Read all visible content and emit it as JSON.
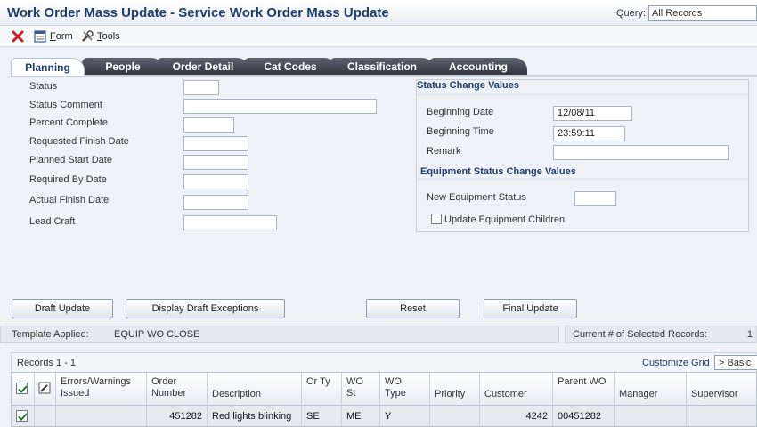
{
  "window": {
    "title": "Work Order Mass Update - Service Work Order Mass Update"
  },
  "query": {
    "label": "Query:",
    "value": "All Records"
  },
  "toolbar": {
    "form_label_u": "F",
    "form_label_rest": "orm",
    "tools_label_u": "T",
    "tools_label_rest": "ools"
  },
  "tabs": [
    {
      "label": "Planning",
      "active": true
    },
    {
      "label": "People"
    },
    {
      "label": "Order Detail"
    },
    {
      "label": "Cat Codes"
    },
    {
      "label": "Classification"
    },
    {
      "label": "Accounting"
    }
  ],
  "planning": {
    "status_label": "Status",
    "status_value": "",
    "status_comment_label": "Status Comment",
    "status_comment_value": "",
    "percent_complete_label": "Percent Complete",
    "percent_complete_value": "",
    "requested_finish_label": "Requested Finish Date",
    "requested_finish_value": "",
    "planned_start_label": "Planned Start Date",
    "planned_start_value": "",
    "required_by_label": "Required By Date",
    "required_by_value": "",
    "actual_finish_label": "Actual Finish Date",
    "actual_finish_value": "",
    "lead_craft_label": "Lead Craft",
    "lead_craft_value": ""
  },
  "status_change": {
    "heading": "Status Change Values",
    "beginning_date_label": "Beginning Date",
    "beginning_date_value": "12/08/11",
    "beginning_time_label": "Beginning Time",
    "beginning_time_value": "23:59:11",
    "remark_label": "Remark",
    "remark_value": ""
  },
  "equipment_change": {
    "heading": "Equipment Status Change Values",
    "new_status_label": "New Equipment Status",
    "new_status_value": "",
    "update_children_label": "Update Equipment Children",
    "update_children_checked": false
  },
  "buttons": {
    "draft_update": "Draft Update",
    "display_draft_exceptions": "Display Draft Exceptions",
    "reset": "Reset",
    "final_update": "Final Update"
  },
  "info": {
    "template_label": "Template Applied:",
    "template_value": "EQUIP WO CLOSE",
    "selected_label": "Current # of Selected Records:",
    "selected_value": "1"
  },
  "grid": {
    "records_label": "Records 1 - 1",
    "customize_label": "Customize Grid",
    "view_label": "> Basic",
    "columns": [
      "Errors/Warnings Issued",
      "Order Number",
      "Description",
      "Or Ty",
      "WO St",
      "WO Type",
      "Priority",
      "Customer",
      "Parent WO",
      "Manager",
      "Supervisor"
    ],
    "rows": [
      {
        "selected": true,
        "errors": "",
        "order_number": "451282",
        "description": "Red lights blinking",
        "or_ty": "SE",
        "wo_st": "ME",
        "wo_type": "Y",
        "priority": "",
        "customer": "4242",
        "parent_wo": "00451282",
        "manager": "",
        "supervisor": ""
      }
    ]
  },
  "colors": {
    "title": "#1e3d6e",
    "tab_dark": "#2f343c",
    "accent_blue": "#1e3d6e"
  }
}
